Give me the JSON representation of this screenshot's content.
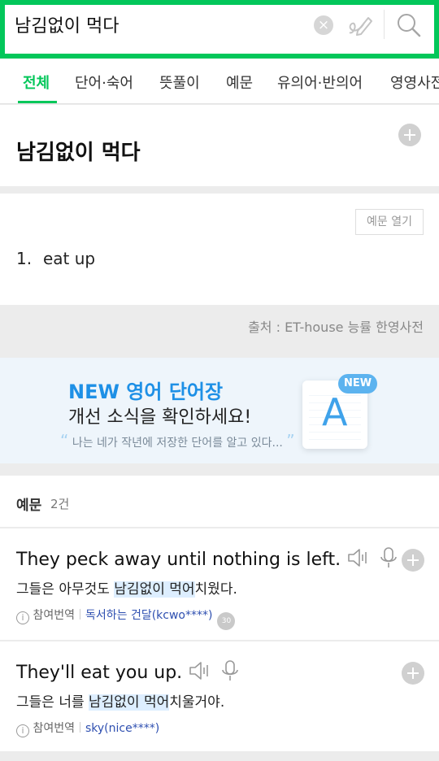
{
  "search": {
    "query": "남김없이 먹다",
    "clear_glyph": "×"
  },
  "tabs": [
    {
      "label": "전체",
      "active": true
    },
    {
      "label": "단어·숙어"
    },
    {
      "label": "뜻풀이"
    },
    {
      "label": "예문"
    },
    {
      "label": "유의어·반의어"
    },
    {
      "label": "영영사전"
    }
  ],
  "entry": {
    "title": "남김없이 먹다",
    "example_open_label": "예문 열기",
    "meanings": [
      {
        "num": "1.",
        "text": "eat up"
      }
    ],
    "source": "출처 : ET-house 능률 한영사전"
  },
  "banner": {
    "title": "NEW 영어 단어장",
    "subtitle": "개선 소식을 확인하세요!",
    "quote": "나는 네가 작년에 저장한 단어를 알고 있다...",
    "badge": "NEW",
    "book_letter": "A"
  },
  "examples": {
    "header_title": "예문",
    "header_count": "2건",
    "items": [
      {
        "en": "They peck away until nothing is left.",
        "ko_pre": "그들은 아무것도 ",
        "ko_hl": "남김없이 먹어",
        "ko_post": "치웠다.",
        "contrib_label": "참여번역",
        "author": "독서하는 건달(kcwo****)",
        "badge": "30"
      },
      {
        "en": "They'll eat you up.",
        "ko_pre": "그들은 너를 ",
        "ko_hl": "남김없이 먹어",
        "ko_post": "치울거야.",
        "contrib_label": "참여번역",
        "author": "sky(nice****)"
      }
    ]
  },
  "colors": {
    "accent": "#03c75a",
    "link": "#2e4fb0",
    "banner_blue": "#1e90e6"
  },
  "icons": [
    "clear-icon",
    "handwriting-icon",
    "search-icon",
    "add-icon",
    "speaker-icon",
    "mic-icon",
    "info-icon"
  ]
}
